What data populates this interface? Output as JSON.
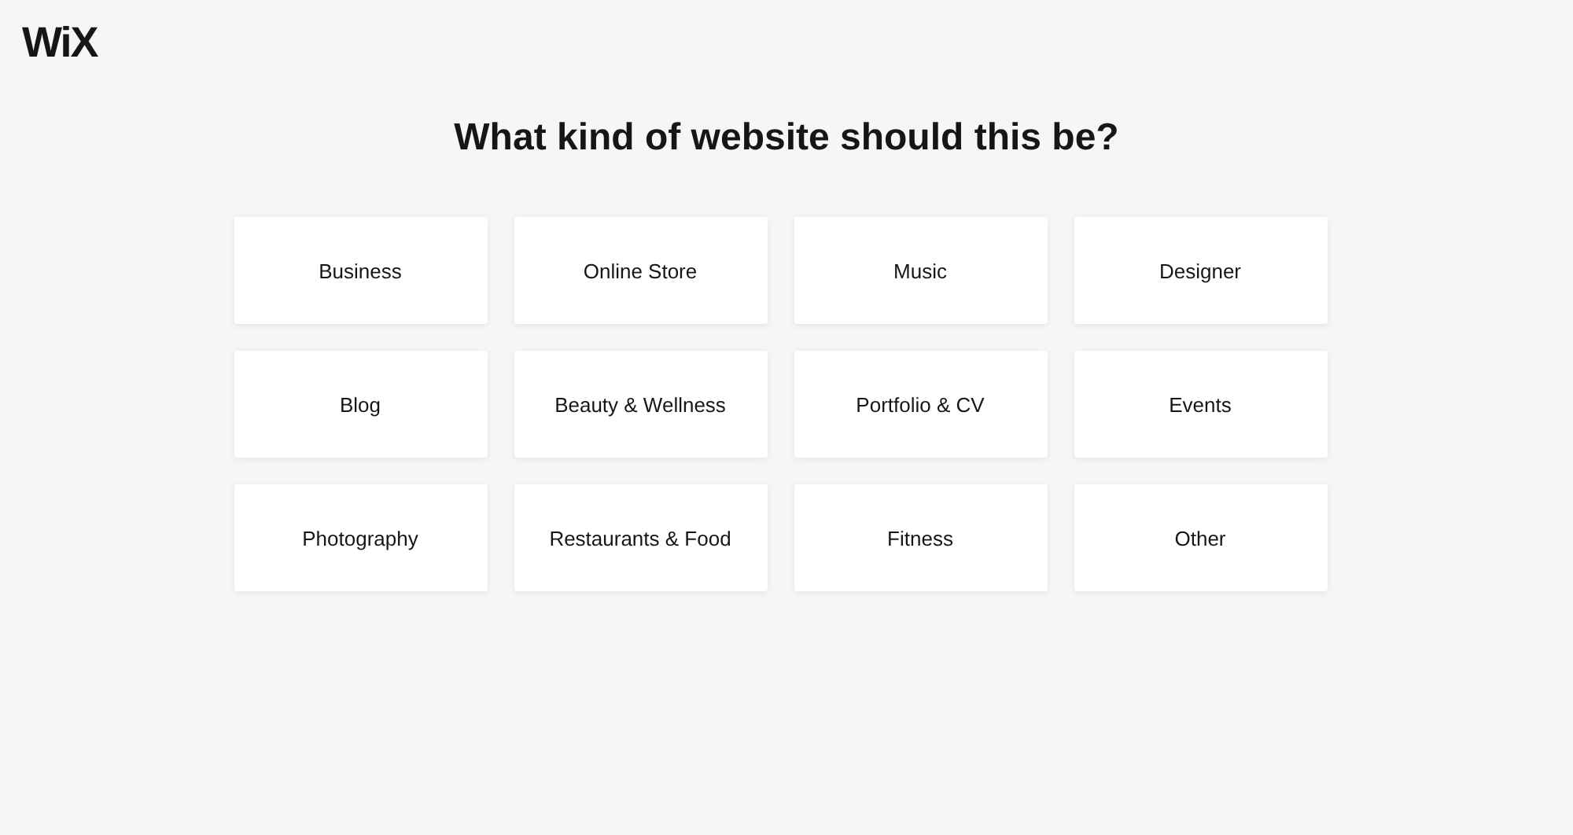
{
  "logo": "WiX",
  "heading": "What kind of website should this be?",
  "categories": [
    "Business",
    "Online Store",
    "Music",
    "Designer",
    "Blog",
    "Beauty & Wellness",
    "Portfolio & CV",
    "Events",
    "Photography",
    "Restaurants & Food",
    "Fitness",
    "Other"
  ]
}
